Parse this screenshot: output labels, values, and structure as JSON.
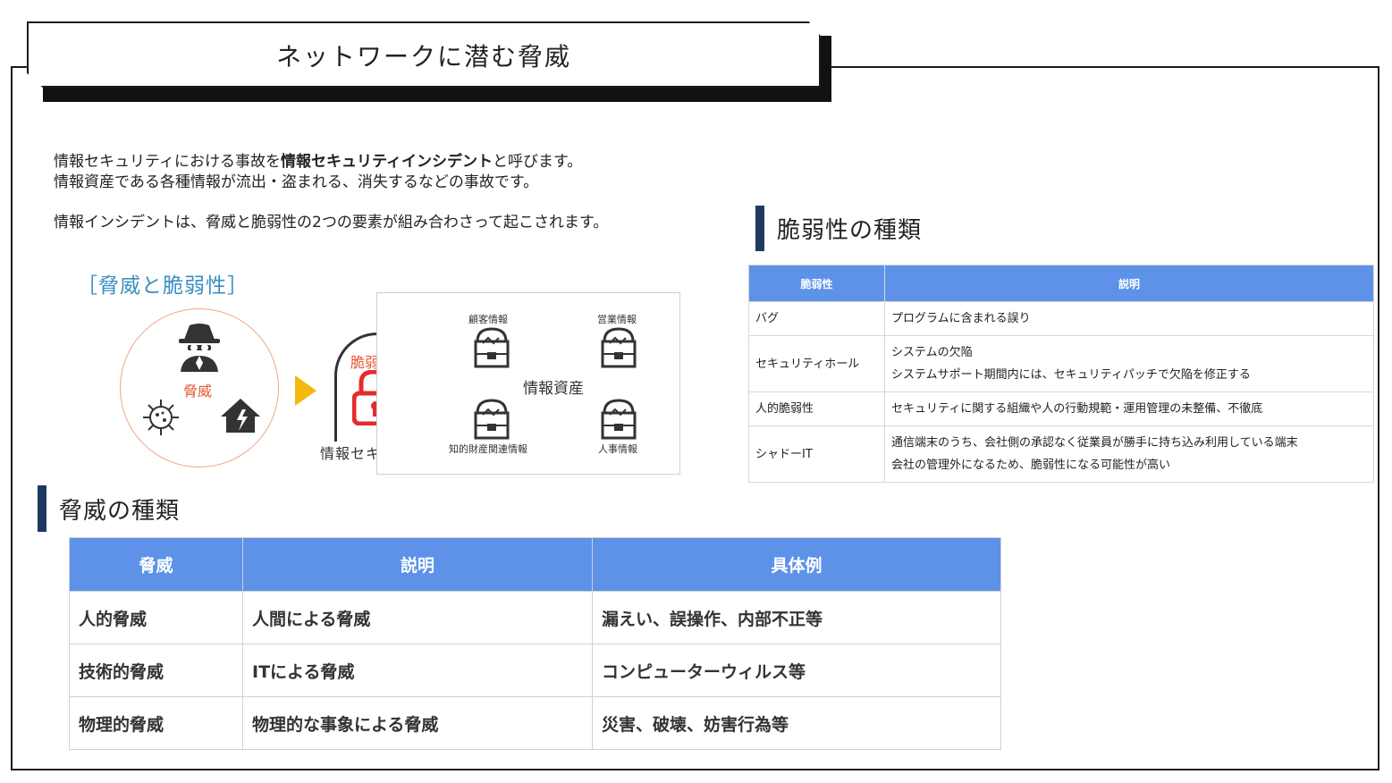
{
  "header": {
    "title": "ネットワークに潜む脅威"
  },
  "intro": {
    "line1_pre": "情報セキュリティにおける事故を",
    "line1_bold": "情報セキュリティインシデント",
    "line1_post": "と呼びます。",
    "line2": "情報資産である各種情報が流出・盗まれる、消失するなどの事故です。",
    "line3": "情報インシデントは、脅威と脆弱性の2つの要素が組み合わさって起こされます。"
  },
  "diagram": {
    "title": "［脅威と脆弱性］",
    "threat_label": "脅威",
    "vulnerability_label": "脆弱性",
    "security_label": "情報セキュリティ",
    "assets_label": "情報資産",
    "asset_items": [
      "顧客情報",
      "営業情報",
      "知的財産関連情報",
      "人事情報"
    ],
    "accent_color": "#e5582f",
    "title_color": "#3a8ec2",
    "arrow_color": "#f5b80f"
  },
  "vuln_section": {
    "heading": "脆弱性の種類",
    "headers": [
      "脆弱性",
      "説明"
    ],
    "rows": [
      {
        "name": "バグ",
        "desc": [
          "プログラムに含まれる誤り"
        ]
      },
      {
        "name": "セキュリティホール",
        "desc": [
          "システムの欠陥",
          "システムサポート期間内には、セキュリティパッチで欠陥を修正する"
        ]
      },
      {
        "name": "人的脆弱性",
        "desc": [
          "セキュリティに関する組織や人の行動規範・運用管理の未整備、不徹底"
        ]
      },
      {
        "name": "シャドーIT",
        "desc": [
          "通信端末のうち、会社側の承認なく従業員が勝手に持ち込み利用している端末",
          "会社の管理外になるため、脆弱性になる可能性が高い"
        ]
      }
    ]
  },
  "threat_section": {
    "heading": "脅威の種類",
    "headers": [
      "脅威",
      "説明",
      "具体例"
    ],
    "rows": [
      [
        "人的脅威",
        "人間による脅威",
        "漏えい、誤操作、内部不正等"
      ],
      [
        "技術的脅威",
        "ITによる脅威",
        "コンピューターウィルス等"
      ],
      [
        "物理的脅威",
        "物理的な事象による脅威",
        "災害、破壊、妨害行為等"
      ]
    ]
  },
  "colors": {
    "table_header": "#5d92e8",
    "section_bar": "#1e3a63"
  }
}
